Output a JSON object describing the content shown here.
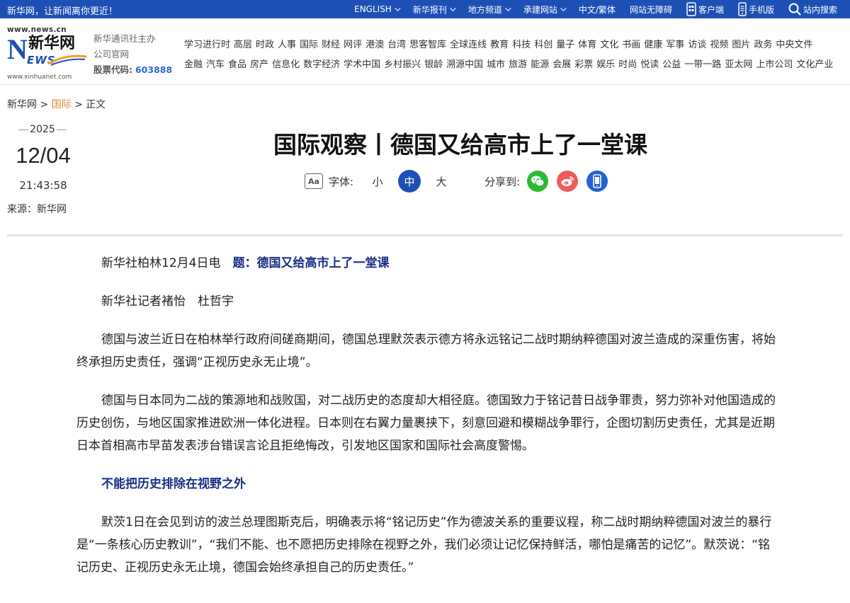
{
  "topbar": {
    "slogan": "新华网，让新闻离你更近！",
    "items": [
      {
        "label": "ENGLISH",
        "dropdown": true
      },
      {
        "label": "新华报刊",
        "dropdown": true
      },
      {
        "label": "地方频道",
        "dropdown": true
      },
      {
        "label": "承建网站",
        "dropdown": true
      },
      {
        "label": "中文/繁体",
        "dropdown": false
      },
      {
        "label": "网站无障碍",
        "dropdown": false
      },
      {
        "label": "客户端",
        "icon": "phone-app-icon"
      },
      {
        "label": "手机版",
        "icon": "mobile-icon"
      },
      {
        "label": "站内搜索",
        "icon": "search-icon"
      }
    ]
  },
  "logo": {
    "domain": "www.news.cn",
    "letter": "N",
    "cn": "新华网",
    "ews": "EWS",
    "domain2": "www.xinhuanet.com"
  },
  "org": {
    "line1": "新华通讯社主办",
    "line2": "公司官网",
    "stock_label": "股票代码:",
    "stock_code": "603888"
  },
  "channels": {
    "row1": [
      "学习进行时",
      "高层",
      "时政",
      "人事",
      "国际",
      "财经",
      "网评",
      "港澳",
      "台湾",
      "思客智库",
      "全球连线",
      "教育",
      "科技",
      "科创",
      "量子",
      "体育",
      "文化",
      "书画",
      "健康",
      "军事",
      "访谈",
      "视频",
      "图片",
      "政务",
      "中央文件"
    ],
    "row2": [
      "金融",
      "汽车",
      "食品",
      "房产",
      "信息化",
      "数字经济",
      "学术中国",
      "乡村振兴",
      "银龄",
      "溯源中国",
      "城市",
      "旅游",
      "能源",
      "会展",
      "彩票",
      "娱乐",
      "时尚",
      "悦读",
      "公益",
      "一带一路",
      "亚太网",
      "上市公司",
      "文化产业"
    ]
  },
  "breadcrumb": {
    "home": "新华网",
    "sep1": " > ",
    "section": "国际",
    "sep2": " > ",
    "current": "正文"
  },
  "meta": {
    "year": "2025",
    "month_day": "12/04",
    "time": "21:43:58",
    "source": "来源：新华网"
  },
  "article": {
    "title": "国际观察丨德国又给高市上了一堂课",
    "font_label": "字体:",
    "font_sizes": [
      "小",
      "中",
      "大"
    ],
    "font_size_selected": "中",
    "share_label": "分享到:",
    "share_icons": [
      "wechat-icon",
      "weibo-icon",
      "mobile-icon"
    ],
    "dateline": "新华社柏林12月4日电",
    "headline_inline": "题：德国又给高市上了一堂课",
    "reporters": "新华社记者褚怡　杜哲宇",
    "p1": "德国与波兰近日在柏林举行政府间磋商期间，德国总理默茨表示德方将永远铭记二战时期纳粹德国对波兰造成的深重伤害，将始终承担历史责任，强调“正视历史永无止境”。",
    "p2": "德国与日本同为二战的策源地和战败国，对二战历史的态度却大相径庭。德国致力于铭记昔日战争罪责，努力弥补对他国造成的历史创伤，与地区国家推进欧洲一体化进程。日本则在右翼力量裹挟下，刻意回避和模糊战争罪行，企图切割历史责任，尤其是近期日本首相高市早苗发表涉台错误言论且拒绝悔改，引发地区国家和国际社会高度警惕。",
    "subhead": "不能把历史排除在视野之外",
    "p3": "默茨1日在会见到访的波兰总理图斯克后，明确表示将“铭记历史”作为德波关系的重要议程，称二战时期纳粹德国对波兰的暴行是“一条核心历史教训”，“我们不能、也不愿把历史排除在视野之外，我们必须让记忆保持鲜活，哪怕是痛苦的记忆”。默茨说：“铭记历史、正视历史永无止境，德国会始终承担自己的历史责任。”"
  },
  "colors": {
    "brand_blue": "#1e4fb5",
    "subhead_navy": "#1a2e86",
    "crumb_orange": "#e08b3a",
    "wechat_green": "#2bbb30",
    "weibo_red": "#ee5a5a",
    "mobile_blue": "#2361d6"
  }
}
